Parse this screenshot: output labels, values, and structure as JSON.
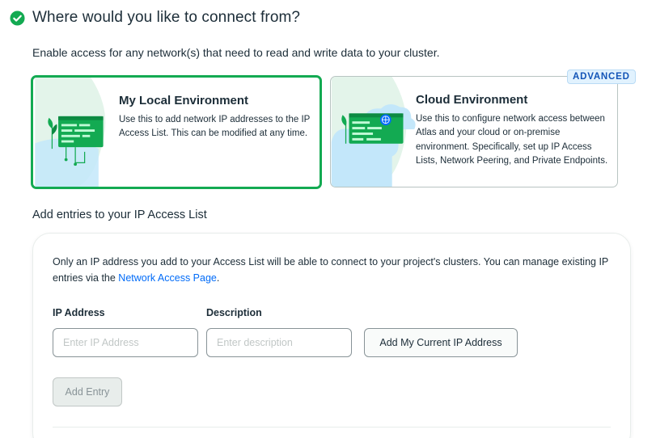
{
  "heading": "Where would you like to connect from?",
  "intro": "Enable access for any network(s) that need to read and write data to your cluster.",
  "colors": {
    "success": "#13aa52",
    "link": "#016bf8",
    "badge_text": "#1254b7"
  },
  "cards": {
    "local": {
      "title": "My Local Environment",
      "description": "Use this to add network IP addresses to the IP Access List. This can be modified at any time.",
      "selected": true
    },
    "cloud": {
      "title": "Cloud Environment",
      "description": "Use this to configure network access between Atlas and your cloud or on-premise environment. Specifically, set up IP Access Lists, Network Peering, and Private Endpoints.",
      "badge": "ADVANCED",
      "selected": false
    }
  },
  "access_list": {
    "section_title": "Add entries to your IP Access List",
    "info_text_before": "Only an IP address you add to your Access List will be able to connect to your project's clusters. You can manage existing IP entries via the ",
    "info_link": "Network Access Page",
    "info_text_after": ".",
    "ip_label": "IP Address",
    "ip_placeholder": "Enter IP Address",
    "desc_label": "Description",
    "desc_placeholder": "Enter description",
    "current_ip_button": "Add My Current IP Address",
    "add_entry_button": "Add Entry"
  }
}
